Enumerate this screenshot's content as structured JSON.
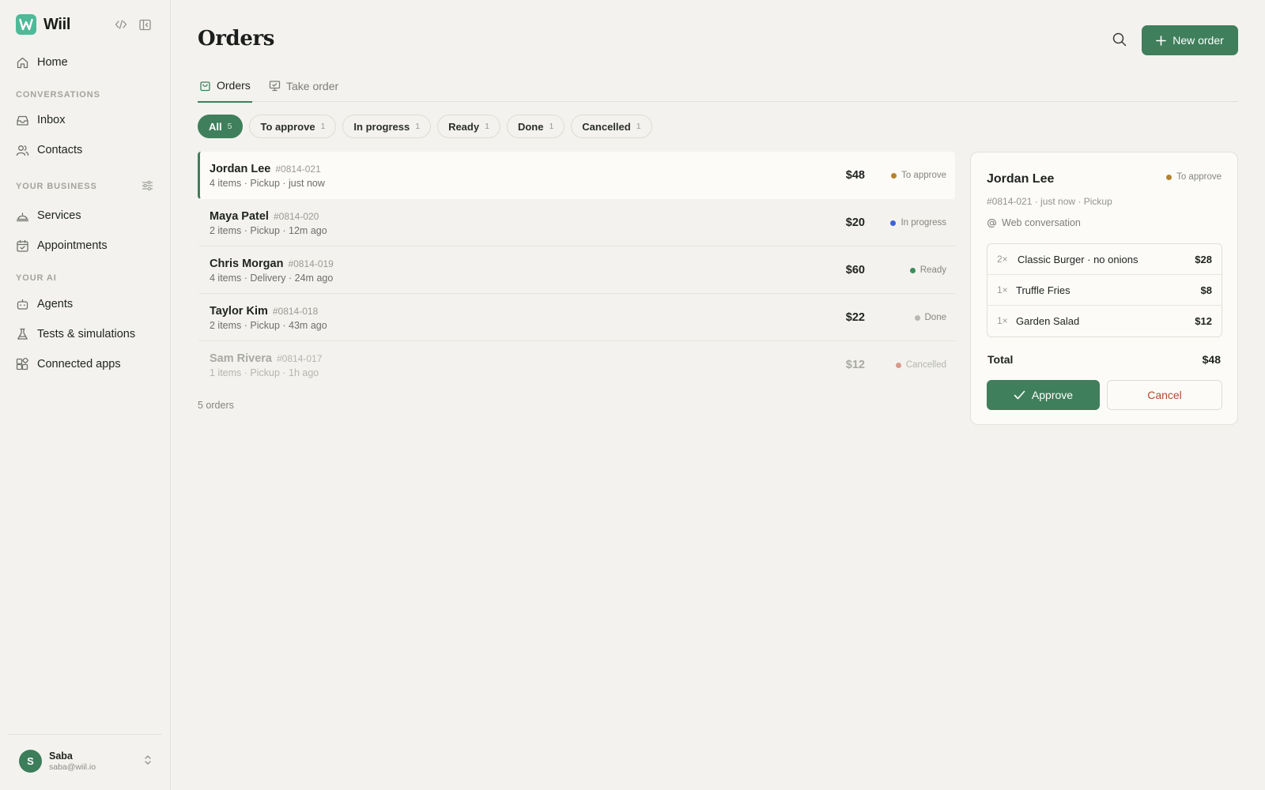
{
  "app": {
    "name": "Wiil",
    "brand_color": "#4fb998",
    "accent_color": "#3f7f5b"
  },
  "sidebar": {
    "home": {
      "label": "Home",
      "icon": "home-icon"
    },
    "sections": {
      "conversations": "CONVERSATIONS",
      "business": "YOUR BUSINESS",
      "ai": "YOUR AI"
    },
    "items": [
      {
        "label": "Inbox",
        "icon": "inbox-icon"
      },
      {
        "label": "Contacts",
        "icon": "contacts-icon"
      },
      {
        "label": "Services",
        "icon": "services-icon"
      },
      {
        "label": "Appointments",
        "icon": "calendar-icon"
      },
      {
        "label": "Agents",
        "icon": "agent-icon"
      },
      {
        "label": "Tests & simulations",
        "icon": "flask-icon"
      },
      {
        "label": "Connected apps",
        "icon": "apps-icon"
      }
    ],
    "user": {
      "initial": "S",
      "name": "Saba",
      "email": "saba@wiil.io"
    }
  },
  "header": {
    "title": "Orders",
    "new_order_label": "New order"
  },
  "tabs": [
    {
      "label": "Orders",
      "icon": "bag-icon",
      "active": true
    },
    {
      "label": "Take order",
      "icon": "monitor-icon",
      "active": false
    }
  ],
  "filters": [
    {
      "label": "All",
      "count": "5",
      "active": true
    },
    {
      "label": "To approve",
      "count": "1"
    },
    {
      "label": "In progress",
      "count": "1"
    },
    {
      "label": "Ready",
      "count": "1"
    },
    {
      "label": "Done",
      "count": "1"
    },
    {
      "label": "Cancelled",
      "count": "1"
    }
  ],
  "orders": [
    {
      "name": "Jordan Lee",
      "id": "#0814-021",
      "meta": "4 items · Pickup · just now",
      "price": "$48",
      "status": "To approve",
      "status_color": "#b5832f"
    },
    {
      "name": "Maya Patel",
      "id": "#0814-020",
      "meta": "2 items · Pickup · 12m ago",
      "price": "$20",
      "status": "In progress",
      "status_color": "#3b63d6"
    },
    {
      "name": "Chris Morgan",
      "id": "#0814-019",
      "meta": "4 items · Delivery · 24m ago",
      "price": "$60",
      "status": "Ready",
      "status_color": "#3f8a5c"
    },
    {
      "name": "Taylor Kim",
      "id": "#0814-018",
      "meta": "2 items · Pickup · 43m ago",
      "price": "$22",
      "status": "Done",
      "status_color": "#b8b9b3"
    },
    {
      "name": "Sam Rivera",
      "id": "#0814-017",
      "meta": "1 items · Pickup · 1h ago",
      "price": "$12",
      "status": "Cancelled",
      "status_color": "#d99a8c"
    }
  ],
  "order_count": "5 orders",
  "detail": {
    "name": "Jordan Lee",
    "status": "To approve",
    "status_color": "#b5832f",
    "sub": "#0814-021 · just now · Pickup",
    "source": "Web conversation",
    "items": [
      {
        "qty": "2×",
        "name": "Classic Burger · no onions",
        "price": "$28"
      },
      {
        "qty": "1×",
        "name": "Truffle Fries",
        "price": "$8"
      },
      {
        "qty": "1×",
        "name": "Garden Salad",
        "price": "$12"
      }
    ],
    "total_label": "Total",
    "total_value": "$48",
    "approve_label": "Approve",
    "cancel_label": "Cancel"
  }
}
